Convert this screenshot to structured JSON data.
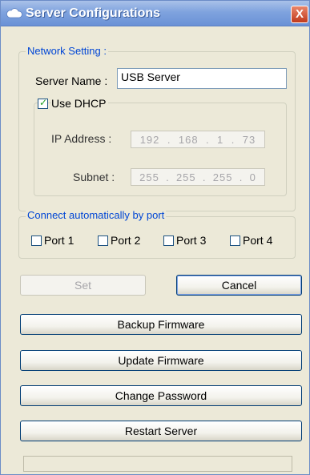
{
  "window": {
    "title": "Server Configurations",
    "close_label": "X"
  },
  "network": {
    "legend": "Network Setting :",
    "server_name_label": "Server Name :",
    "server_name_value": "USB Server",
    "dhcp_label": "Use DHCP",
    "dhcp_checked": true,
    "ip_label": "IP Address :",
    "ip": [
      "192",
      "168",
      "1",
      "73"
    ],
    "subnet_label": "Subnet :",
    "subnet": [
      "255",
      "255",
      "255",
      "0"
    ]
  },
  "ports": {
    "legend": "Connect automatically by port",
    "items": [
      {
        "label": "Port 1",
        "checked": false
      },
      {
        "label": "Port 2",
        "checked": false
      },
      {
        "label": "Port 3",
        "checked": false
      },
      {
        "label": "Port 4",
        "checked": false
      }
    ]
  },
  "buttons": {
    "set": "Set",
    "cancel": "Cancel",
    "backup": "Backup Firmware",
    "update": "Update Firmware",
    "password": "Change Password",
    "restart": "Restart Server"
  }
}
